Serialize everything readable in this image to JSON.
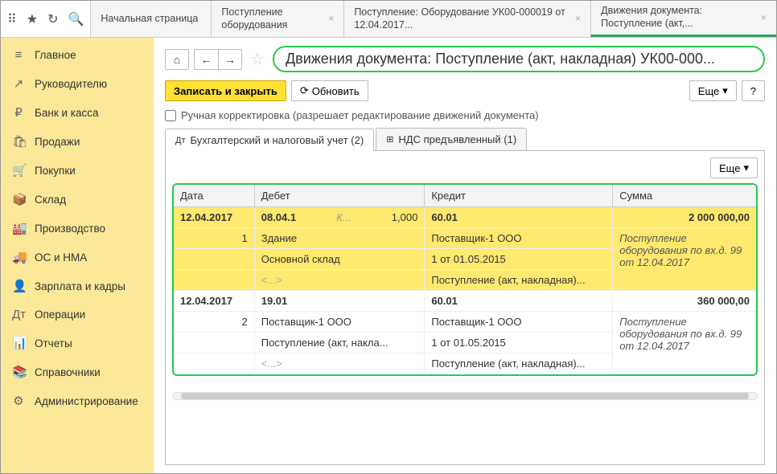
{
  "topbar": {
    "tabs": [
      {
        "label": "Начальная страница",
        "close": ""
      },
      {
        "label": "Поступление оборудования",
        "close": "×"
      },
      {
        "label": "Поступление: Оборудование УК00-000019 от 12.04.2017...",
        "close": "×"
      },
      {
        "label": "Движения документа: Поступление (акт,...",
        "close": "×",
        "active": true
      }
    ]
  },
  "sidebar": {
    "items": [
      {
        "icon": "≡",
        "label": "Главное"
      },
      {
        "icon": "↗",
        "label": "Руководителю"
      },
      {
        "icon": "₽",
        "label": "Банк и касса"
      },
      {
        "icon": "🛍",
        "label": "Продажи"
      },
      {
        "icon": "🛒",
        "label": "Покупки"
      },
      {
        "icon": "📦",
        "label": "Склад"
      },
      {
        "icon": "🏭",
        "label": "Производство"
      },
      {
        "icon": "🚚",
        "label": "ОС и НМА"
      },
      {
        "icon": "👤",
        "label": "Зарплата и кадры"
      },
      {
        "icon": "Дт",
        "label": "Операции"
      },
      {
        "icon": "📊",
        "label": "Отчеты"
      },
      {
        "icon": "📚",
        "label": "Справочники"
      },
      {
        "icon": "⚙",
        "label": "Администрирование"
      }
    ]
  },
  "nav": {
    "home": "⌂",
    "back": "←",
    "fwd": "→"
  },
  "title": "Движения документа: Поступление (акт, накладная) УК00-000...",
  "actions": {
    "write_close": "Записать и закрыть",
    "refresh": "Обновить",
    "more": "Еще",
    "help": "?"
  },
  "checkbox": {
    "label": "Ручная корректировка (разрешает редактирование движений документа)"
  },
  "subtabs": [
    {
      "label": "Бухгалтерский и налоговый учет (2)",
      "active": true,
      "icon": "Дт"
    },
    {
      "label": "НДС предъявленный (1)",
      "icon": "⊞"
    }
  ],
  "grid_more": "Еще",
  "headers": {
    "date": "Дата",
    "debit": "Дебет",
    "credit": "Кредит",
    "sum": "Сумма"
  },
  "rows": [
    {
      "hl": true,
      "date": "12.04.2017",
      "num": "1",
      "debit_acc": "08.04.1",
      "debit_k": "К...",
      "debit_q": "1,000",
      "credit_acc": "60.01",
      "sum": "2 000 000,00",
      "d1": "Здание",
      "c1": "Поставщик-1 ООО",
      "s_note": "Поступление оборудования по вх.д. 99 от 12.04.2017",
      "d2": "Основной склад",
      "c2": "1 от 01.05.2015",
      "d3": "<...>",
      "c3": "Поступление (акт, накладная)..."
    },
    {
      "hl": false,
      "date": "12.04.2017",
      "num": "2",
      "debit_acc": "19.01",
      "debit_k": "",
      "debit_q": "",
      "credit_acc": "60.01",
      "sum": "360 000,00",
      "d1": "Поставщик-1 ООО",
      "c1": "Поставщик-1 ООО",
      "s_note": "Поступление оборудования по вх.д. 99 от 12.04.2017",
      "d2": "Поступление (акт, накла...",
      "c2": "1 от 01.05.2015",
      "d3": "<...>",
      "c3": "Поступление (акт, накладная)..."
    }
  ]
}
